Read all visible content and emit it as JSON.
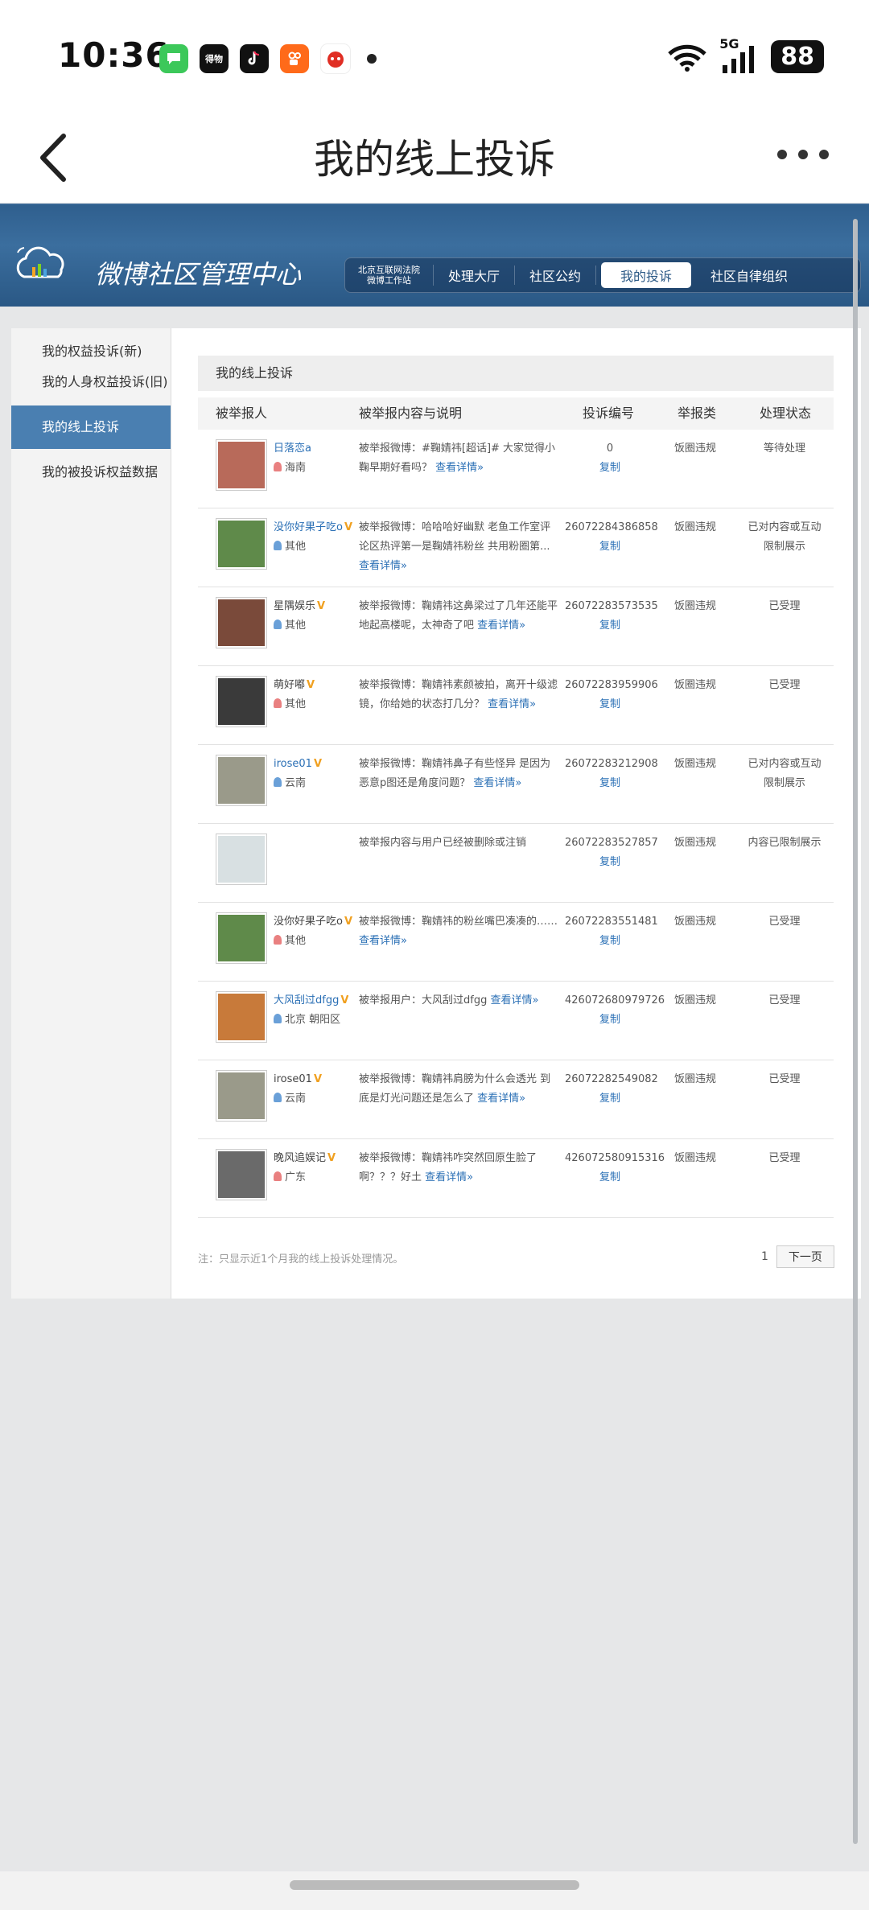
{
  "status_bar": {
    "time": "10:36",
    "network": "5G",
    "battery": "88"
  },
  "nav": {
    "title": "我的线上投诉"
  },
  "site": {
    "title": "微博社区管理中心",
    "menu": [
      {
        "label": "北京互联网法院\n微博工作站"
      },
      {
        "label": "处理大厅"
      },
      {
        "label": "社区公约"
      },
      {
        "label": "我的投诉"
      },
      {
        "label": "社区自律组织"
      }
    ]
  },
  "sidebar": {
    "items": [
      {
        "label": "我的权益投诉(新)"
      },
      {
        "label": "我的人身权益投诉(旧)"
      },
      {
        "label": "我的线上投诉"
      },
      {
        "label": "我的被投诉权益数据"
      }
    ]
  },
  "content": {
    "title": "我的线上投诉",
    "columns": {
      "user": "被举报人",
      "content": "被举报内容与说明",
      "id": "投诉编号",
      "category": "举报类",
      "status": "处理状态"
    },
    "detail_link": "查看详情»",
    "copy_label": "复制",
    "rows": [
      {
        "name": "日落恋a",
        "verified": "",
        "location": "海南",
        "content": "被举报微博：#鞠婧祎[超话]# 大家觉得小鞠早期好看吗？",
        "id": "0",
        "category": "饭圈违规",
        "status": "等待处理",
        "avatar_color": "#b86a5a"
      },
      {
        "name": "没你好果子吃o",
        "verified": "V",
        "location": "其他",
        "content": "被举报微博：哈哈哈好幽默 老鱼工作室评论区热评第一是鞠婧祎粉丝 共用粉圈第...",
        "id": "26072284386858",
        "category": "饭圈违规",
        "status": "已对内容或互动限制展示",
        "avatar_color": "#5f8a4a"
      },
      {
        "name": "星隅娱乐",
        "verified": "V",
        "location": "其他",
        "content": "被举报微博：鞠婧祎这鼻梁过了几年还能平地起高楼呢，太神奇了吧",
        "id": "26072283573535",
        "category": "饭圈违规",
        "status": "已受理",
        "avatar_color": "#7a4a3a"
      },
      {
        "name": "萌好嘟",
        "verified": "V",
        "location": "其他",
        "content": "被举报微博：鞠婧祎素颜被拍，离开十级滤镜，你给她的状态打几分？",
        "id": "26072283959906",
        "category": "饭圈违规",
        "status": "已受理",
        "avatar_color": "#3a3a3a"
      },
      {
        "name": "irose01",
        "verified": "V",
        "location": "云南",
        "content": "被举报微博：鞠婧祎鼻子有些怪异 是因为恶意p图还是角度问题？",
        "id": "26072283212908",
        "category": "饭圈违规",
        "status": "已对内容或互动限制展示",
        "avatar_color": "#9a9a8a"
      },
      {
        "name": "",
        "verified": "",
        "location": "",
        "content": "被举报内容与用户已经被删除或注销",
        "id": "26072283527857",
        "category": "饭圈违规",
        "status": "内容已限制展示",
        "avatar_color": "#d8e0e2"
      },
      {
        "name": "没你好果子吃o",
        "verified": "V",
        "location": "其他",
        "content": "被举报微博：鞠婧祎的粉丝嘴巴凑凑的……",
        "id": "26072283551481",
        "category": "饭圈违规",
        "status": "已受理",
        "avatar_color": "#5f8a4a"
      },
      {
        "name": "大风刮过dfgg",
        "verified": "V",
        "location": "北京 朝阳区",
        "content": "被举报用户：大风刮过dfgg",
        "id": "426072680979726",
        "category": "饭圈违规",
        "status": "已受理",
        "avatar_color": "#c87a3a"
      },
      {
        "name": "irose01",
        "verified": "V",
        "location": "云南",
        "content": "被举报微博：鞠婧祎肩膀为什么会透光 到底是灯光问题还是怎么了",
        "id": "26072282549082",
        "category": "饭圈违规",
        "status": "已受理",
        "avatar_color": "#9a9a8a"
      },
      {
        "name": "晚风追娱记",
        "verified": "V",
        "location": "广东",
        "content": "被举报微博：鞠婧祎咋突然回原生脸了啊？？？好土",
        "id": "426072580915316",
        "category": "饭圈违规",
        "status": "已受理",
        "avatar_color": "#6a6a6a"
      }
    ]
  },
  "footer": {
    "note": "注：只显示近1个月我的线上投诉处理情况。",
    "page": "1",
    "next": "下一页"
  }
}
